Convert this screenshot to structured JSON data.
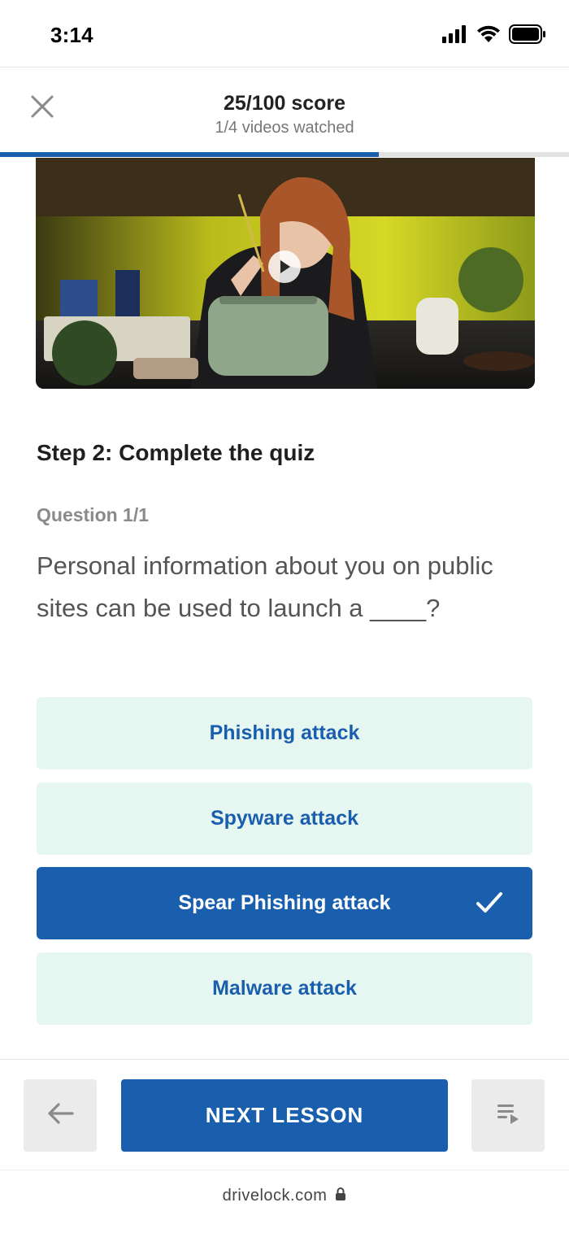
{
  "status_bar": {
    "time": "3:14",
    "icons": [
      "signal-icon",
      "wifi-icon",
      "battery-icon"
    ]
  },
  "header": {
    "score": "25/100 score",
    "videos_watched": "1/4 videos watched",
    "close_icon": "close-icon",
    "progress_fraction": 0.666
  },
  "video": {
    "play_icon": "play-icon"
  },
  "quiz": {
    "step_title": "Step 2: Complete the quiz",
    "question_number": "Question 1/1",
    "question_text": "Personal information about you on public sites can be used to launch a ____?",
    "options": [
      {
        "label": "Phishing attack",
        "selected": false
      },
      {
        "label": "Spyware attack",
        "selected": false
      },
      {
        "label": "Spear Phishing attack",
        "selected": true
      },
      {
        "label": "Malware attack",
        "selected": false
      }
    ]
  },
  "bottom_nav": {
    "back_icon": "arrow-left-icon",
    "next_label": "NEXT LESSON",
    "list_icon": "playlist-icon"
  },
  "browser": {
    "url": "drivelock.com",
    "lock_icon": "lock-icon"
  },
  "colors": {
    "primary": "#1a5fad",
    "option_bg": "#e6f6f1",
    "muted_text": "#8a8a8a"
  }
}
